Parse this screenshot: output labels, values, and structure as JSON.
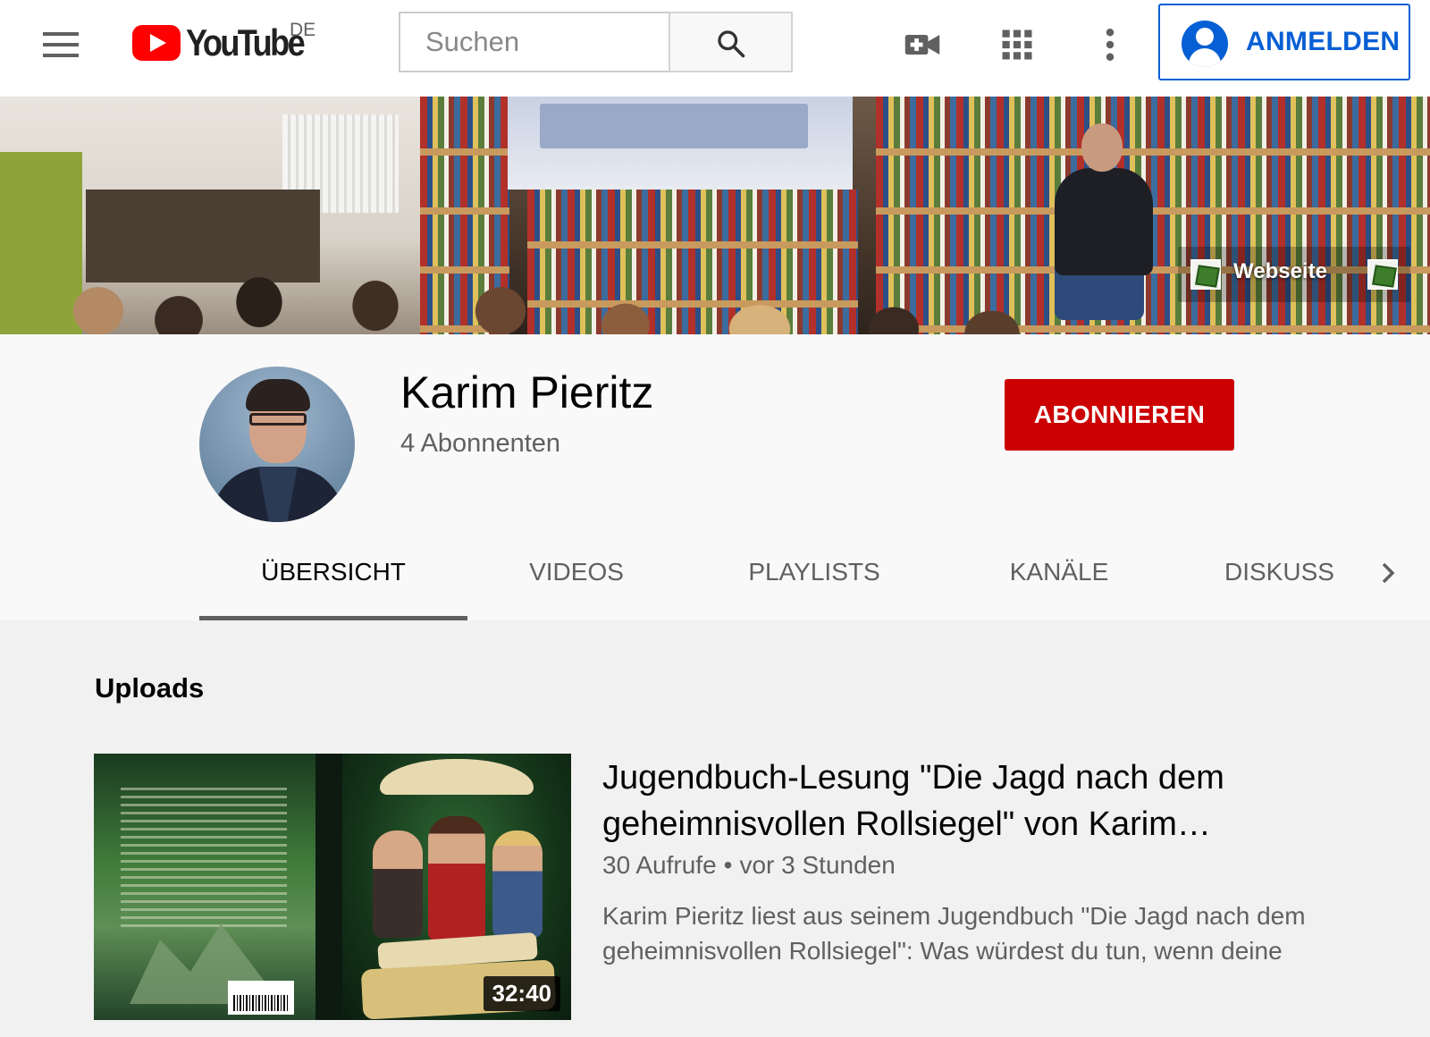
{
  "masthead": {
    "logo_text": "YouTube",
    "country_code": "DE",
    "search_placeholder": "Suchen",
    "signin_label": "ANMELDEN",
    "icons": [
      "menu-icon",
      "search-icon",
      "video-create-icon",
      "apps-grid-icon",
      "more-vert-icon",
      "account-icon"
    ]
  },
  "banner": {
    "link_label": "Webseite"
  },
  "channel": {
    "name": "Karim Pieritz",
    "subscribers": "4 Abonnenten",
    "subscribe_label": "ABONNIEREN"
  },
  "tabs": [
    {
      "label": "ÜBERSICHT",
      "active": true
    },
    {
      "label": "VIDEOS",
      "active": false
    },
    {
      "label": "PLAYLISTS",
      "active": false
    },
    {
      "label": "KANÄLE",
      "active": false
    },
    {
      "label": "DISKUSSION",
      "active": false
    }
  ],
  "uploads": {
    "section_title": "Uploads",
    "video": {
      "title": "Jugendbuch-Lesung \"Die Jagd nach dem geheimnisvollen Rollsiegel\" von Karim…",
      "views": "30 Aufrufe",
      "age": "vor 3 Stunden",
      "duration": "32:40",
      "description": "Karim Pieritz liest aus seinem Jugendbuch \"Die Jagd nach dem geheimnisvollen Rollsiegel\": Was würdest du tun, wenn deine"
    }
  },
  "colors": {
    "brand_red": "#ff0000",
    "subscribe_red": "#cc0000",
    "link_blue": "#065fd4"
  }
}
